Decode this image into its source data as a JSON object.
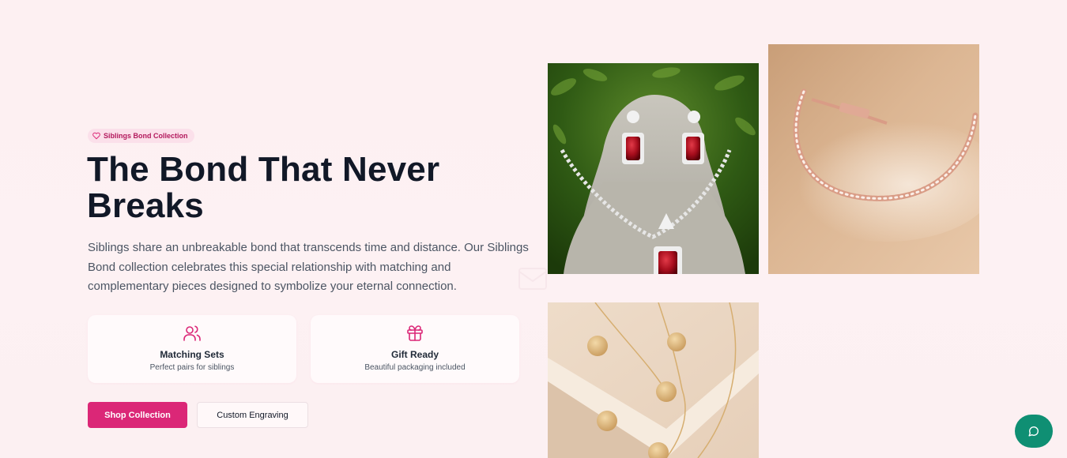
{
  "hero": {
    "badge": "Siblings Bond Collection",
    "title": "The Bond That Never Breaks",
    "description": "Siblings share an unbreakable bond that transcends time and distance. Our Siblings Bond collection celebrates this special relationship with matching and complementary pieces designed to symbolize your eternal connection."
  },
  "features": [
    {
      "icon": "users-icon",
      "title": "Matching Sets",
      "subtitle": "Perfect pairs for siblings"
    },
    {
      "icon": "gift-icon",
      "title": "Gift Ready",
      "subtitle": "Beautiful packaging included"
    }
  ],
  "buttons": {
    "primary": "Shop Collection",
    "secondary": "Custom Engraving"
  },
  "images": [
    {
      "subject": "ruby-necklace-earrings-set"
    },
    {
      "subject": "rose-gold-tennis-bracelet"
    },
    {
      "subject": "gold-coin-pendant-necklaces"
    }
  ],
  "colors": {
    "accent": "#db2777",
    "heading": "#111827",
    "chat": "#0f8f73"
  },
  "chat": {
    "icon": "chat-bubble-icon"
  }
}
